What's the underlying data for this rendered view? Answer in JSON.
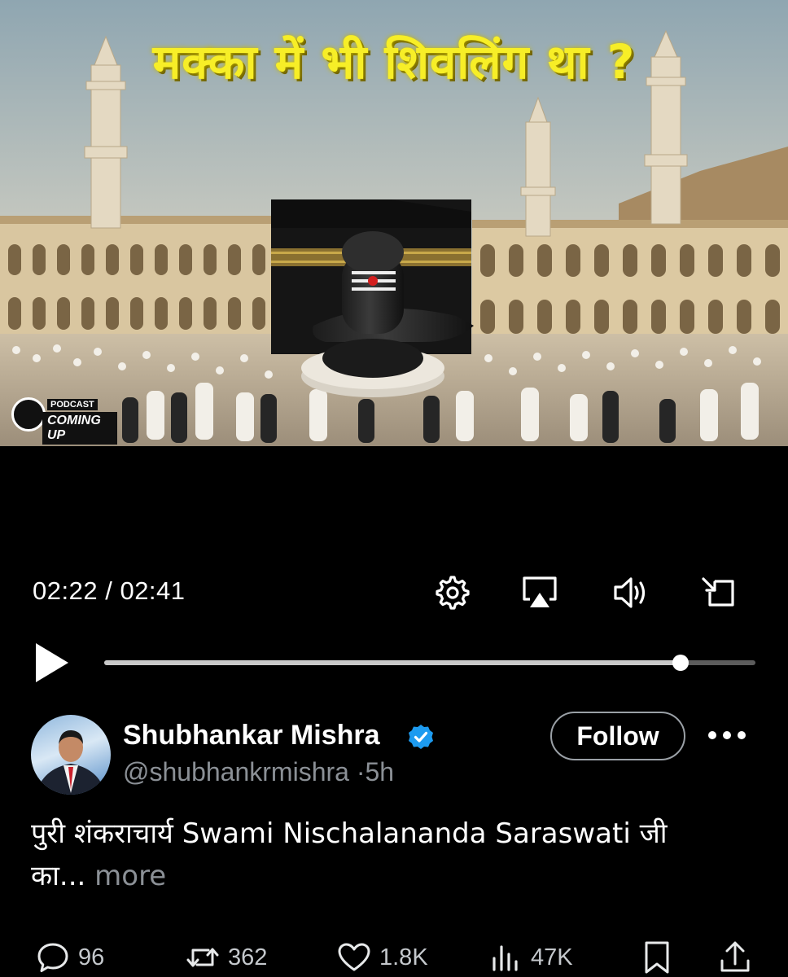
{
  "video": {
    "headline": "मक्का में भी शिवलिंग था ?",
    "badge_podcast": "PODCAST",
    "badge_coming_up": "COMING UP",
    "current_time": "02:22",
    "separator": "/",
    "duration": "02:41",
    "progress_fraction": 0.885,
    "icons": [
      "gear-icon",
      "airplay-icon",
      "volume-icon",
      "exit-fullscreen-icon",
      "play-icon"
    ]
  },
  "post": {
    "author_name": "Shubhankar Mishra",
    "handle": "@shubhankrmishra",
    "dot": "·",
    "time_ago": "5h",
    "follow_label": "Follow",
    "text_line1": "पुरी शंकराचार्य Swami Nischalananda Saraswati जी",
    "text_line2": "का...",
    "more_label": "more",
    "verified_color": "#1d9bf0"
  },
  "actions": {
    "replies": "96",
    "reposts": "362",
    "likes": "1.8K",
    "views": "47K"
  }
}
